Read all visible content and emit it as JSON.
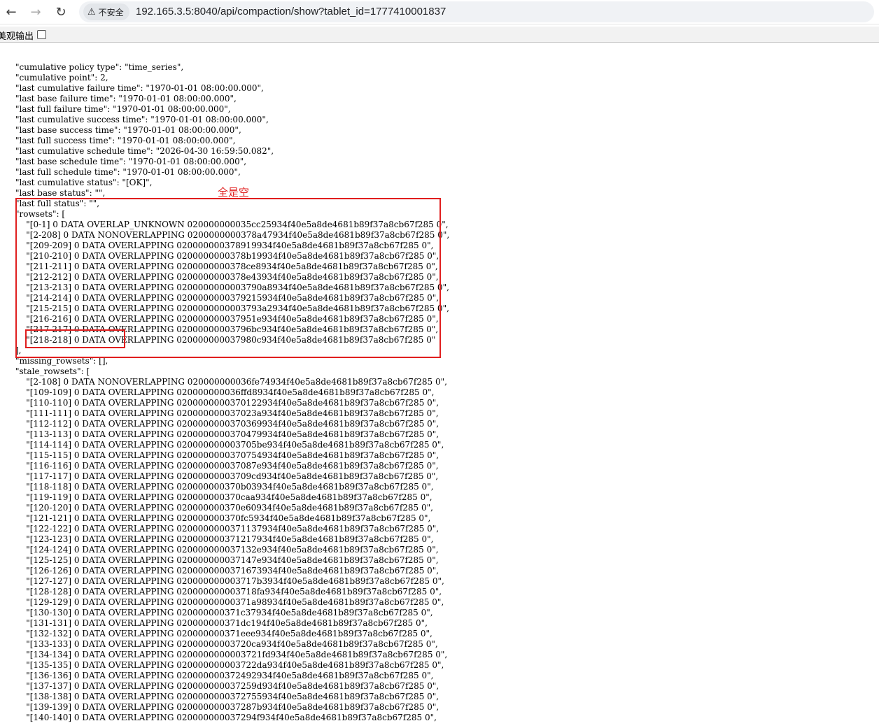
{
  "browser": {
    "back_glyph": "←",
    "forward_glyph": "→",
    "reload_glyph": "↻",
    "warning_glyph": "⚠",
    "security_label": "不安全",
    "url": "192.165.3.5:8040/api/compaction/show?tablet_id=1777410001837"
  },
  "pretty_print": {
    "label": "美观输出",
    "checked": false
  },
  "annotation": {
    "note": "全是空",
    "color": "#e01e1e"
  },
  "json_lines": [
    "\"cumulative policy type\": \"time_series\",",
    "\"cumulative point\": 2,",
    "\"last cumulative failure time\": \"1970-01-01 08:00:00.000\",",
    "\"last base failure time\": \"1970-01-01 08:00:00.000\",",
    "\"last full failure time\": \"1970-01-01 08:00:00.000\",",
    "\"last cumulative success time\": \"1970-01-01 08:00:00.000\",",
    "\"last base success time\": \"1970-01-01 08:00:00.000\",",
    "\"last full success time\": \"1970-01-01 08:00:00.000\",",
    "\"last cumulative schedule time\": \"2026-04-30 16:59:50.082\",",
    "\"last base schedule time\": \"1970-01-01 08:00:00.000\",",
    "\"last full schedule time\": \"1970-01-01 08:00:00.000\",",
    "\"last cumulative status\": \"[OK]\",",
    "\"last base status\": \"\",",
    "\"last full status\": \"\",",
    "\"rowsets\": [",
    "    \"[0-1] 0 DATA OVERLAP_UNKNOWN 020000000035cc25934f40e5a8de4681b89f37a8cb67f285 0\",",
    "    \"[2-208] 0 DATA NONOVERLAPPING 0200000000378a47934f40e5a8de4681b89f37a8cb67f285 0\",",
    "    \"[209-209] 0 DATA OVERLAPPING 020000000378919934f40e5a8de4681b89f37a8cb67f285 0\",",
    "    \"[210-210] 0 DATA OVERLAPPING 0200000000378b19934f40e5a8de4681b89f37a8cb67f285 0\",",
    "    \"[211-211] 0 DATA OVERLAPPING 0200000000378ce8934f40e5a8de4681b89f37a8cb67f285 0\",",
    "    \"[212-212] 0 DATA OVERLAPPING 0200000000378e43934f40e5a8de4681b89f37a8cb67f285 0\",",
    "    \"[213-213] 0 DATA OVERLAPPING 0200000000003790a8934f40e5a8de4681b89f37a8cb67f285 0\",",
    "    \"[214-214] 0 DATA OVERLAPPING 0200000000379215934f40e5a8de4681b89f37a8cb67f285 0\",",
    "    \"[215-215] 0 DATA OVERLAPPING 0200000000003793a2934f40e5a8de4681b89f37a8cb67f285 0\",",
    "    \"[216-216] 0 DATA OVERLAPPING 020000000037951e934f40e5a8de4681b89f37a8cb67f285 0\",",
    "    \"[217-217] 0 DATA OVERLAPPING 02000000003796bc934f40e5a8de4681b89f37a8cb67f285 0\",",
    "    \"[218-218] 0 DATA OVERLAPPING 020000000037980c934f40e5a8de4681b89f37a8cb67f285 0\"",
    "],",
    "\"missing_rowsets\": [],",
    "\"stale_rowsets\": [",
    "    \"[2-108] 0 DATA NONOVERLAPPING 020000000036fe74934f40e5a8de4681b89f37a8cb67f285 0\",",
    "    \"[109-109] 0 DATA OVERLAPPING 020000000036ffd8934f40e5a8de4681b89f37a8cb67f285 0\",",
    "    \"[110-110] 0 DATA OVERLAPPING 0200000000370122934f40e5a8de4681b89f37a8cb67f285 0\",",
    "    \"[111-111] 0 DATA OVERLAPPING 020000000037023a934f40e5a8de4681b89f37a8cb67f285 0\",",
    "    \"[112-112] 0 DATA OVERLAPPING 0200000000370369934f40e5a8de4681b89f37a8cb67f285 0\",",
    "    \"[113-113] 0 DATA OVERLAPPING 0200000000370479934f40e5a8de4681b89f37a8cb67f285 0\",",
    "    \"[114-114] 0 DATA OVERLAPPING 020000000003705be934f40e5a8de4681b89f37a8cb67f285 0\",",
    "    \"[115-115] 0 DATA OVERLAPPING 0200000000370754934f40e5a8de4681b89f37a8cb67f285 0\",",
    "    \"[116-116] 0 DATA OVERLAPPING 020000000037087e934f40e5a8de4681b89f37a8cb67f285 0\",",
    "    \"[117-117] 0 DATA OVERLAPPING 02000000003709cd934f40e5a8de4681b89f37a8cb67f285 0\",",
    "    \"[118-118] 0 DATA OVERLAPPING 020000000370b03934f40e5a8de4681b89f37a8cb67f285 0\",",
    "    \"[119-119] 0 DATA OVERLAPPING 020000000370caa934f40e5a8de4681b89f37a8cb67f285 0\",",
    "    \"[120-120] 0 DATA OVERLAPPING 020000000370e60934f40e5a8de4681b89f37a8cb67f285 0\",",
    "    \"[121-121] 0 DATA OVERLAPPING 020000000370fc5934f40e5a8de4681b89f37a8cb67f285 0\",",
    "    \"[122-122] 0 DATA OVERLAPPING 0200000000371137934f40e5a8de4681b89f37a8cb67f285 0\",",
    "    \"[123-123] 0 DATA OVERLAPPING 020000000371217934f40e5a8de4681b89f37a8cb67f285 0\",",
    "    \"[124-124] 0 DATA OVERLAPPING 020000000037132e934f40e5a8de4681b89f37a8cb67f285 0\",",
    "    \"[125-125] 0 DATA OVERLAPPING 020000000037147e934f40e5a8de4681b89f37a8cb67f285 0\",",
    "    \"[126-126] 0 DATA OVERLAPPING 0200000000371673934f40e5a8de4681b89f37a8cb67f285 0\",",
    "    \"[127-127] 0 DATA OVERLAPPING 020000000003717b3934f40e5a8de4681b89f37a8cb67f285 0\",",
    "    \"[128-128] 0 DATA OVERLAPPING 020000000003718fa934f40e5a8de4681b89f37a8cb67f285 0\",",
    "    \"[129-129] 0 DATA OVERLAPPING 02000000000371a98934f40e5a8de4681b89f37a8cb67f285 0\",",
    "    \"[130-130] 0 DATA OVERLAPPING 020000000371c37934f40e5a8de4681b89f37a8cb67f285 0\",",
    "    \"[131-131] 0 DATA OVERLAPPING 020000000371dc194f40e5a8de4681b89f37a8cb67f285 0\",",
    "    \"[132-132] 0 DATA OVERLAPPING 020000000371eee934f40e5a8de4681b89f37a8cb67f285 0\",",
    "    \"[133-133] 0 DATA OVERLAPPING 02000000003720ca934f40e5a8de4681b89f37a8cb67f285 0\",",
    "    \"[134-134] 0 DATA OVERLAPPING 0200000000003721fd934f40e5a8de4681b89f37a8cb67f285 0\",",
    "    \"[135-135] 0 DATA OVERLAPPING 020000000003722da934f40e5a8de4681b89f37a8cb67f285 0\",",
    "    \"[136-136] 0 DATA OVERLAPPING 020000000372492934f40e5a8de4681b89f37a8cb67f285 0\",",
    "    \"[137-137] 0 DATA OVERLAPPING 020000000037259d934f40e5a8de4681b89f37a8cb67f285 0\",",
    "    \"[138-138] 0 DATA OVERLAPPING 0200000000372755934f40e5a8de4681b89f37a8cb67f285 0\",",
    "    \"[139-139] 0 DATA OVERLAPPING 020000000037287b934f40e5a8de4681b89f37a8cb67f285 0\",",
    "    \"[140-140] 0 DATA OVERLAPPING 020000000037294f934f40e5a8de4681b89f37a8cb67f285 0\","
  ]
}
